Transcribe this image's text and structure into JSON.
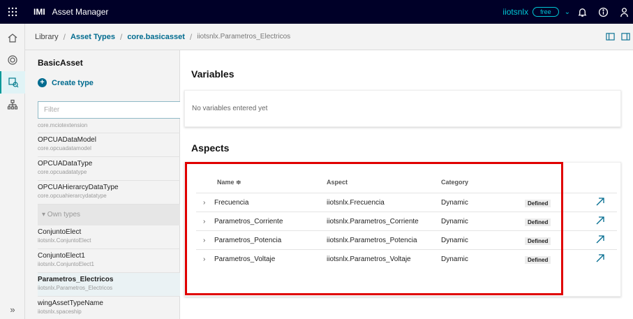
{
  "topbar": {
    "brand": "IMI",
    "app_title": "Asset Manager",
    "tenant": "iiotsnlx",
    "plan": "free",
    "chevron": "⌄",
    "icons": [
      "apps-grid-icon",
      "bell-icon",
      "info-icon",
      "user-icon"
    ]
  },
  "rail": {
    "items": [
      "home-icon",
      "asset-icon",
      "asset-types-icon",
      "hierarchy-icon"
    ],
    "expand": "»"
  },
  "breadcrumb": {
    "items": [
      {
        "label": "Library",
        "link": false
      },
      {
        "label": "Asset Types",
        "link": true
      },
      {
        "label": "core.basicasset",
        "link": true
      },
      {
        "label": "iiotsnlx.Parametros_Electricos",
        "link": false
      }
    ],
    "separator": "/"
  },
  "sidebar": {
    "title": "BasicAsset",
    "create_label": "Create type",
    "filter_placeholder": "Filter",
    "items": [
      {
        "name": "",
        "id": "core.mciotextension"
      },
      {
        "name": "OPCUADataModel",
        "id": "core.opcuadatamodel"
      },
      {
        "name": "OPCUADataType",
        "id": "core.opcuadatatype"
      },
      {
        "name": "OPCUAHierarcyDataType",
        "id": "core.opcuahierarcydatatype"
      }
    ],
    "group_label": "▾ Own types",
    "own_items": [
      {
        "name": "ConjuntoElect",
        "id": "iiotsnlx.ConjuntoElect",
        "selected": false
      },
      {
        "name": "ConjuntoElect1",
        "id": "iiotsnlx.ConjuntoElect1",
        "selected": false
      },
      {
        "name": "Parametros_Electricos",
        "id": "iiotsnlx.Parametros_Electricos",
        "selected": true
      },
      {
        "name": "wingAssetTypeName",
        "id": "iiotsnlx.spaceship",
        "selected": false
      }
    ]
  },
  "variables": {
    "title": "Variables",
    "empty_text": "No variables entered yet"
  },
  "aspects": {
    "title": "Aspects",
    "columns": [
      "Name ≑",
      "Aspect",
      "Category"
    ],
    "rows": [
      {
        "name": "Frecuencia",
        "aspect": "iiotsnlx.Frecuencia",
        "category": "Dynamic",
        "status": "Defined"
      },
      {
        "name": "Parametros_Corriente",
        "aspect": "iiotsnlx.Parametros_Corriente",
        "category": "Dynamic",
        "status": "Defined"
      },
      {
        "name": "Parametros_Potencia",
        "aspect": "iiotsnlx.Parametros_Potencia",
        "category": "Dynamic",
        "status": "Defined"
      },
      {
        "name": "Parametros_Voltaje",
        "aspect": "iiotsnlx.Parametros_Voltaje",
        "category": "Dynamic",
        "status": "Defined"
      }
    ],
    "expand_glyph": "›"
  },
  "colors": {
    "topbar": "#000028",
    "accent": "#00c8d7",
    "link": "#006b8f",
    "highlight": "#e00000"
  }
}
